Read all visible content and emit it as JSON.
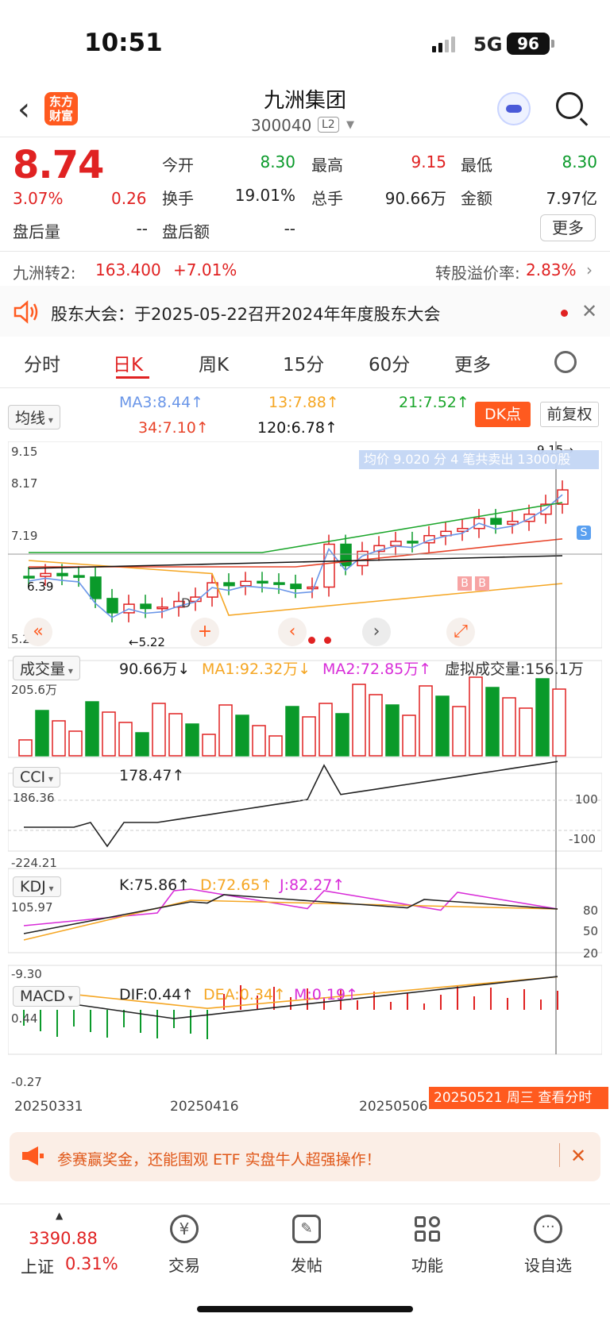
{
  "status": {
    "time": "10:51",
    "network": "5G",
    "battery": "96"
  },
  "header": {
    "back_icon": "chevron-left-icon",
    "logo_text": "东方财富",
    "title": "九洲集团",
    "code": "300040",
    "level": "L2"
  },
  "quote": {
    "price": "8.74",
    "pct": "3.07%",
    "change": "0.26",
    "open_label": "今开",
    "open": "8.30",
    "high_label": "最高",
    "high": "9.15",
    "low_label": "最低",
    "low": "8.30",
    "turnover_label": "换手",
    "turnover": "19.01%",
    "volume_label": "总手",
    "volume": "90.66万",
    "amount_label": "金额",
    "amount": "7.97亿",
    "ah_vol_label": "盘后量",
    "ah_vol": "--",
    "ah_amt_label": "盘后额",
    "ah_amt": "--",
    "more": "更多"
  },
  "bond": {
    "name": "九洲转2:",
    "price": "163.400",
    "pct": "+7.01%",
    "premium_label": "转股溢价率:",
    "premium": "2.83%"
  },
  "notice": {
    "text": "股东大会：于2025-05-22召开2024年年度股东大会"
  },
  "tabs": [
    "分时",
    "日K",
    "周K",
    "15分",
    "60分",
    "更多"
  ],
  "ma_row": {
    "select": "均线",
    "ma3": "MA3:8.44↑",
    "ma13": "13:7.88↑",
    "ma21": "21:7.52↑",
    "ma34": "34:7.10↑",
    "ma120": "120:6.78↑",
    "dk": "DK点",
    "fq": "前复权"
  },
  "kline_axis": {
    "top": "9.15",
    "a": "8.17",
    "b": "7.19",
    "c": "6.39",
    "low": "5.22",
    "high_mark": "9.15→",
    "low_mark": "←5.22",
    "d": "D",
    "b_mark": "B"
  },
  "tooltip": "均价 9.020 分 4 笔共卖出 13000股",
  "vol_row": {
    "select": "成交量",
    "vol": "90.66万↓",
    "ma1": "MA1:92.32万↓",
    "ma2": "MA2:72.85万↑",
    "virtual": "虚拟成交量:156.1万",
    "max": "205.6万"
  },
  "cci_row": {
    "select": "CCI",
    "value": "178.47↑",
    "top": "186.36",
    "bottom": "-224.21",
    "p100": "100",
    "m100": "-100"
  },
  "kdj_row": {
    "select": "KDJ",
    "k": "K:75.86↑",
    "d": "D:72.65↑",
    "j": "J:82.27↑",
    "top": "105.97",
    "bottom": "-9.30",
    "l80": "80",
    "l50": "50",
    "l20": "20"
  },
  "macd_row": {
    "select": "MACD",
    "dif": "DIF:0.44↑",
    "dea": "DEA:0.34↑",
    "m": "M:0.19↑",
    "top": "0.44",
    "bottom": "-0.27"
  },
  "dates": [
    "20250331",
    "20250416",
    "20250506"
  ],
  "date_bar": "20250521 周三 查看分时",
  "banner": "参赛赢奖金，还能围观 ETF 实盘牛人超强操作！",
  "bottom_nav": {
    "index_value": "3390.88",
    "index_name": "上证",
    "index_pct": "0.31%",
    "trade": "交易",
    "post": "发帖",
    "func": "功能",
    "watch": "设自选"
  },
  "colors": {
    "up": "#e02222",
    "down": "#0a9a2a",
    "accent": "#ff5a1f"
  }
}
